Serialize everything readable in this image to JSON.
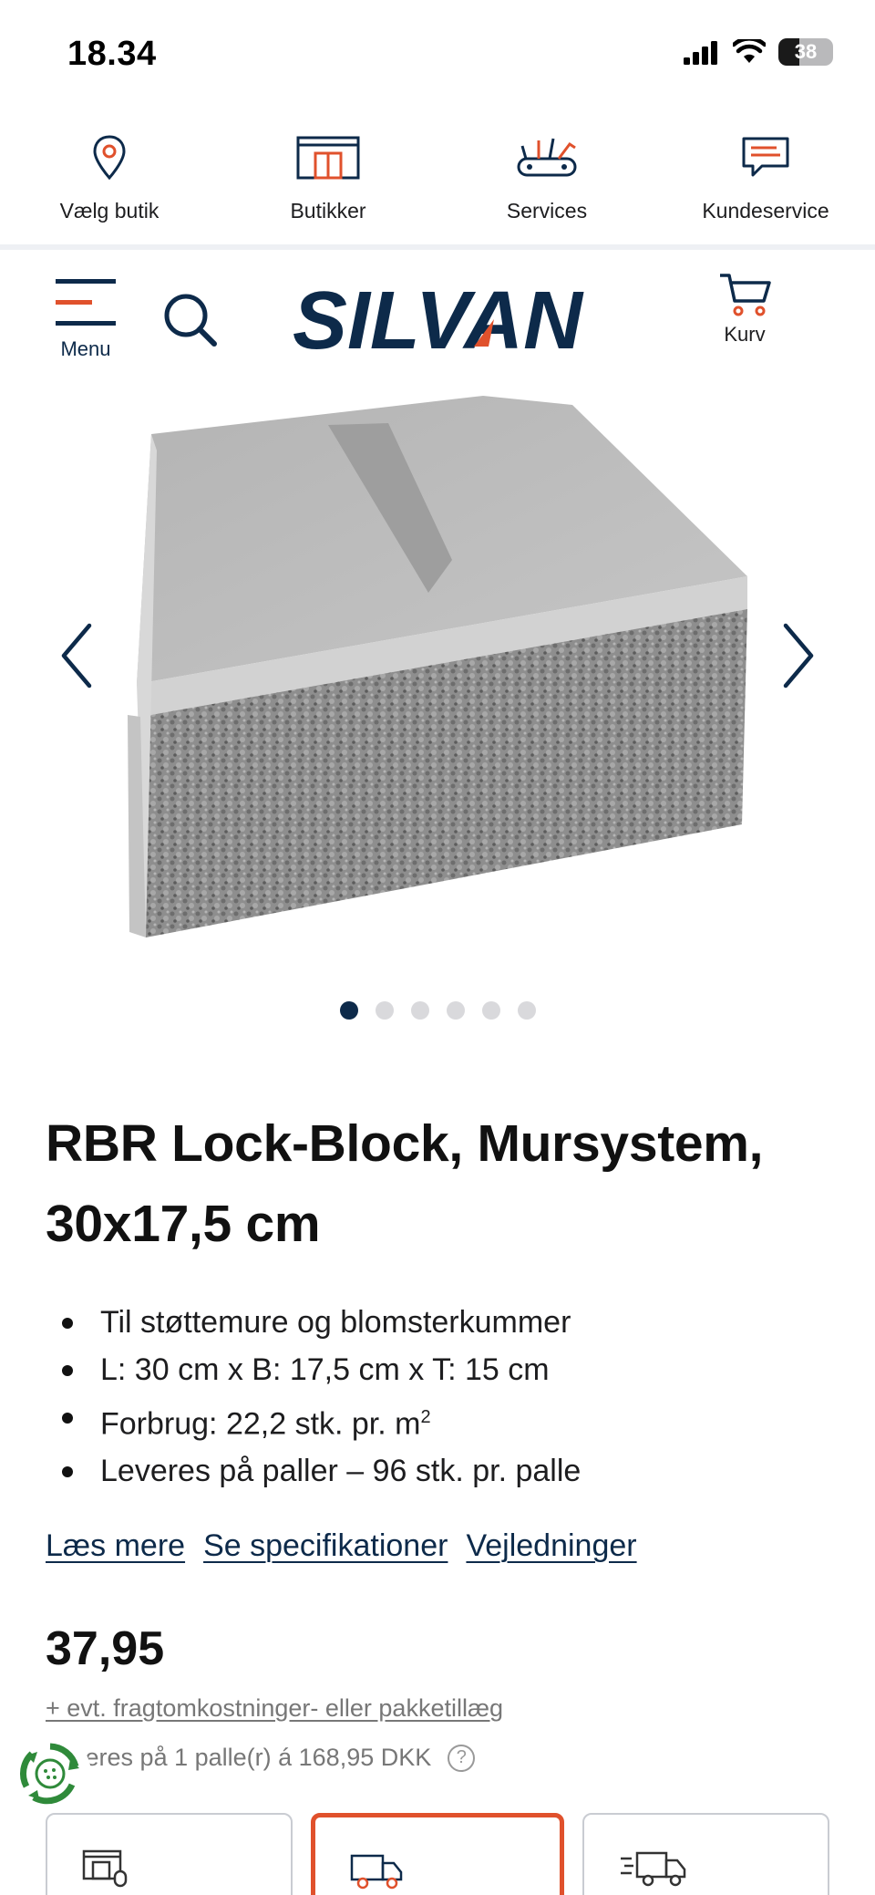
{
  "status_bar": {
    "time": "18.34",
    "battery": "38"
  },
  "service_nav": [
    {
      "label": "Vælg butik",
      "icon": "map-pin-icon"
    },
    {
      "label": "Butikker",
      "icon": "store-icon"
    },
    {
      "label": "Services",
      "icon": "tools-icon"
    },
    {
      "label": "Kundeservice",
      "icon": "chat-icon"
    }
  ],
  "header": {
    "menu_label": "Menu",
    "logo_text": "SILVAN",
    "cart_label": "Kurv"
  },
  "gallery": {
    "slide_count": 6,
    "active_slide": 1
  },
  "product": {
    "title": "RBR Lock-Block, Mursystem, 30x17,5 cm",
    "bullets": {
      "b1": "Til støttemure og blomsterkummer",
      "b2": "L: 30 cm x B: 17,5 cm x T: 15 cm",
      "b3": "Forbrug: 22,2 stk. pr. m",
      "b3_sup": "2",
      "b4": "Leveres på paller – 96 stk. pr. palle"
    },
    "links": {
      "read_more": "Læs mere",
      "specs": "Se specifikationer",
      "guides": "Vejledninger"
    },
    "price": "37,95",
    "freight_link": "+ evt. fragtomkostninger- eller pakketillæg",
    "delivery_note": "Leveres på 1 palle(r) á 168,95 DKK"
  },
  "delivery_options": [
    {
      "icon": "click-collect-icon",
      "selected": false
    },
    {
      "icon": "delivery-truck-icon",
      "selected": true
    },
    {
      "icon": "fast-delivery-icon",
      "selected": false
    }
  ],
  "colors": {
    "brand_navy": "#0d2a4a",
    "accent_orange": "#e0512c"
  }
}
